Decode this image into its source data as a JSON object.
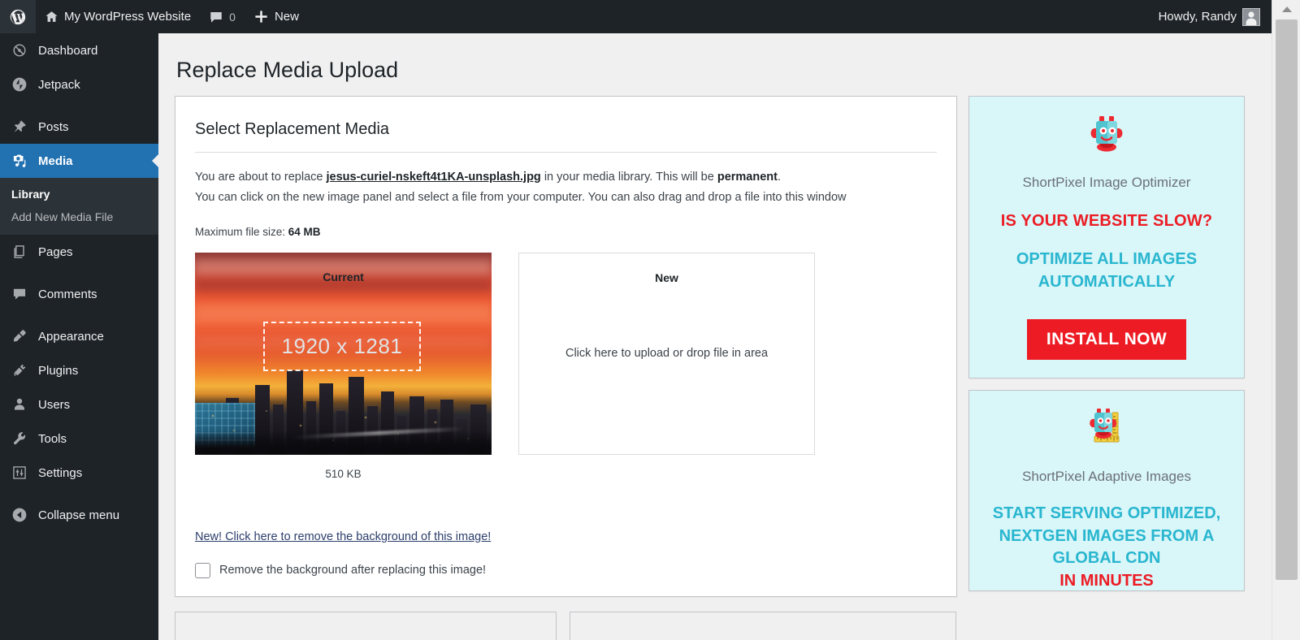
{
  "adminbar": {
    "logo_icon": "wordpress-logo-icon",
    "home_icon": "home-icon",
    "site_name": "My WordPress Website",
    "comments_icon": "comment-bubble-icon",
    "comment_count": "0",
    "new_icon": "plus-icon",
    "new_label": "New",
    "howdy": "Howdy, Randy",
    "avatar_icon": "user-avatar-icon"
  },
  "sidebar": {
    "items": [
      {
        "label": "Dashboard",
        "icon": "dashboard-gauge-icon",
        "current": false
      },
      {
        "label": "Jetpack",
        "icon": "jetpack-bolt-icon",
        "current": false
      },
      {
        "label": "Posts",
        "icon": "pushpin-icon",
        "current": false
      },
      {
        "label": "Media",
        "icon": "media-camera-music-icon",
        "current": true
      },
      {
        "label": "Pages",
        "icon": "pages-stack-icon",
        "current": false
      },
      {
        "label": "Comments",
        "icon": "comment-bubble-icon",
        "current": false
      },
      {
        "label": "Appearance",
        "icon": "paintbrush-icon",
        "current": false
      },
      {
        "label": "Plugins",
        "icon": "plug-icon",
        "current": false
      },
      {
        "label": "Users",
        "icon": "user-icon",
        "current": false
      },
      {
        "label": "Tools",
        "icon": "wrench-icon",
        "current": false
      },
      {
        "label": "Settings",
        "icon": "sliders-icon",
        "current": false
      },
      {
        "label": "Collapse menu",
        "icon": "collapse-arrow-icon",
        "current": false
      }
    ],
    "submenu": [
      {
        "label": "Library",
        "current": true
      },
      {
        "label": "Add New Media File",
        "current": false
      }
    ]
  },
  "page": {
    "title": "Replace Media Upload",
    "box_title": "Select Replacement Media",
    "intro_prefix": "You are about to replace ",
    "filename": "jesus-curiel-nskeft4t1KA-unsplash.jpg",
    "intro_middle": " in your media library. This will be ",
    "intro_bold": "permanent",
    "intro_suffix": ".",
    "intro_line2": "You can click on the new image panel and select a file from your computer. You can also drag and drop a file into this window",
    "maxsize_label": "Maximum file size: ",
    "maxsize_value": "64 MB",
    "current_label": "Current",
    "current_dimensions": "1920 x 1281",
    "current_filesize": "510 KB",
    "new_label": "New",
    "drop_hint": "Click here to upload or drop file in area",
    "bg_remove_link": "New! Click here to remove the background of this image!",
    "bg_remove_checkbox_label": "Remove the background after replacing this image!",
    "bg_remove_checked": false
  },
  "ads": [
    {
      "icon": "shortpixel-robot-icon",
      "name": "ShortPixel Image Optimizer",
      "headline": "IS YOUR WEBSITE SLOW?",
      "subline": "OPTIMIZE ALL IMAGES AUTOMATICALLY",
      "button": "INSTALL NOW",
      "footer_red": ""
    },
    {
      "icon": "shortpixel-robot-ruler-icon",
      "name": "ShortPixel Adaptive Images",
      "headline": "",
      "subline": "START SERVING OPTIMIZED, NEXTGEN IMAGES FROM A GLOBAL CDN",
      "button": "",
      "footer_red": "IN MINUTES"
    }
  ],
  "colors": {
    "admin_dark": "#1d2327",
    "accent_blue": "#2271b1",
    "ad_bg": "#d9f6f9",
    "ad_red": "#ec1c24",
    "ad_cyan": "#29b6cf",
    "page_bg": "#f0f0f1"
  },
  "scrollbar": {
    "up_arrow_icon": "triangle-up-icon"
  }
}
